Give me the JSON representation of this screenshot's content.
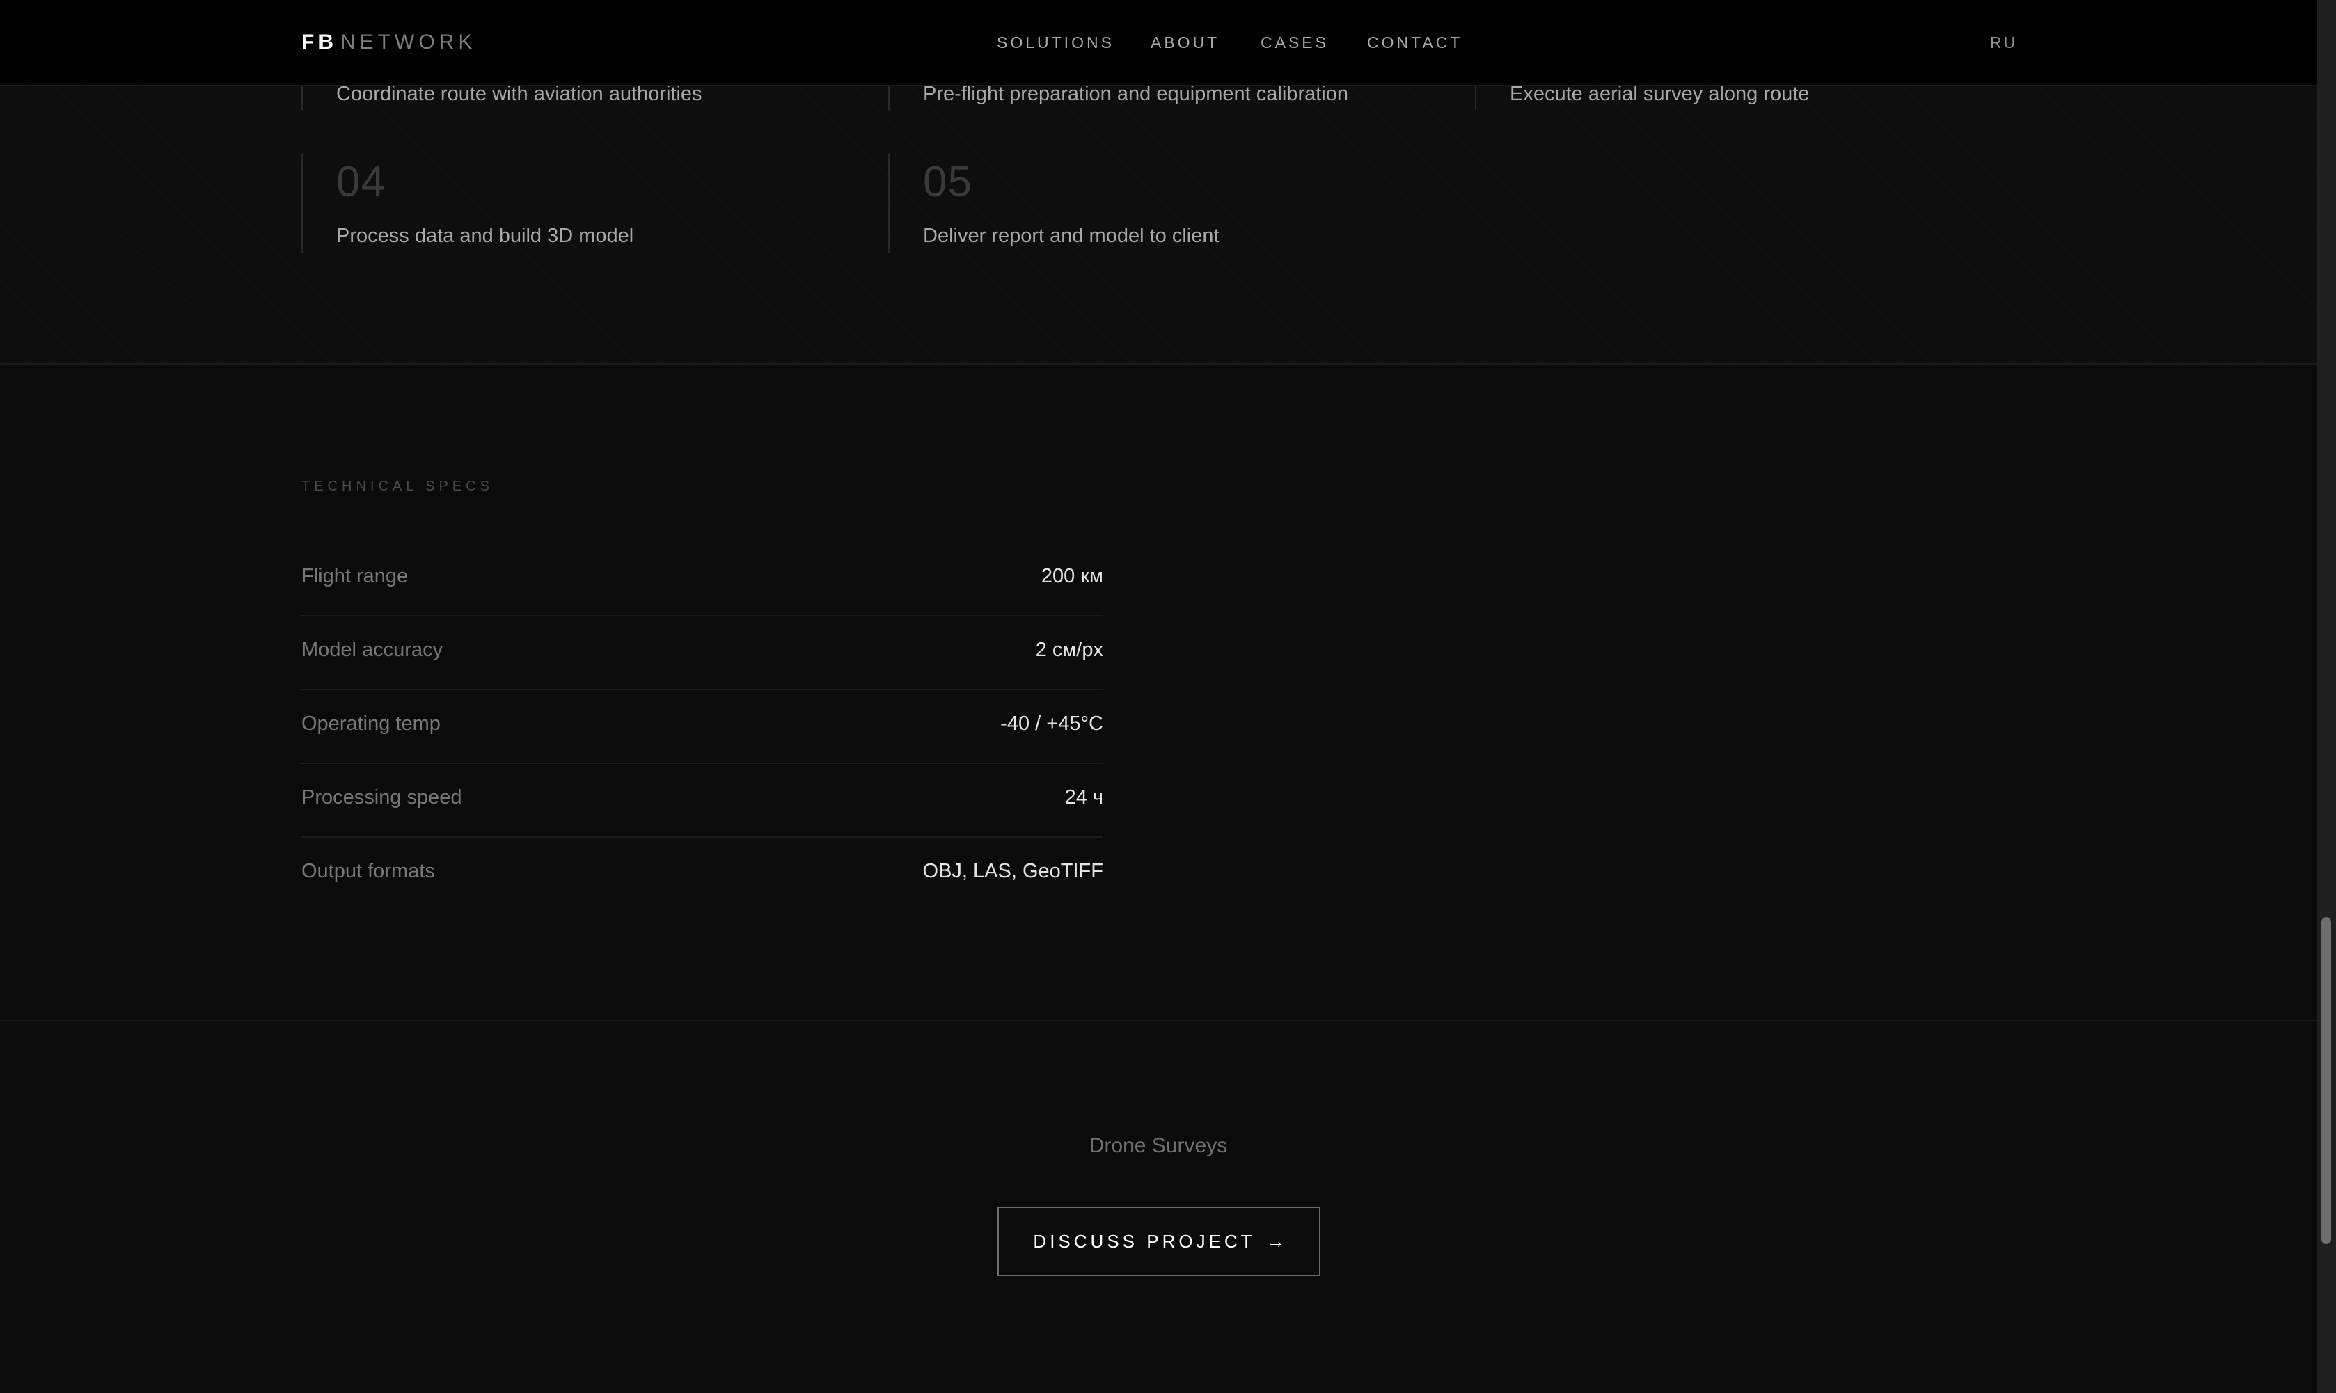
{
  "nav": {
    "logo_bold": "FB",
    "logo_light": "NETWORK",
    "links": [
      "SOLUTIONS",
      "ABOUT",
      "CASES",
      "CONTACT"
    ],
    "lang": "RU"
  },
  "process": {
    "steps": [
      {
        "number": "",
        "text": "Coordinate route with aviation authorities"
      },
      {
        "number": "",
        "text": "Pre-flight preparation and equipment calibration"
      },
      {
        "number": "",
        "text": "Execute aerial survey along route"
      },
      {
        "number": "04",
        "text": "Process data and build 3D model"
      },
      {
        "number": "05",
        "text": "Deliver report and model to client"
      }
    ]
  },
  "specs": {
    "label": "TECHNICAL SPECS",
    "rows": [
      {
        "label": "Flight range",
        "value": "200 км"
      },
      {
        "label": "Model accuracy",
        "value": "2 см/px"
      },
      {
        "label": "Operating temp",
        "value": "-40 / +45°C"
      },
      {
        "label": "Processing speed",
        "value": "24 ч"
      },
      {
        "label": "Output formats",
        "value": "OBJ, LAS, GeoTIFF"
      }
    ]
  },
  "cta": {
    "subtitle": "Drone Surveys",
    "button_label": "DISCUSS PROJECT",
    "button_arrow": "→"
  }
}
